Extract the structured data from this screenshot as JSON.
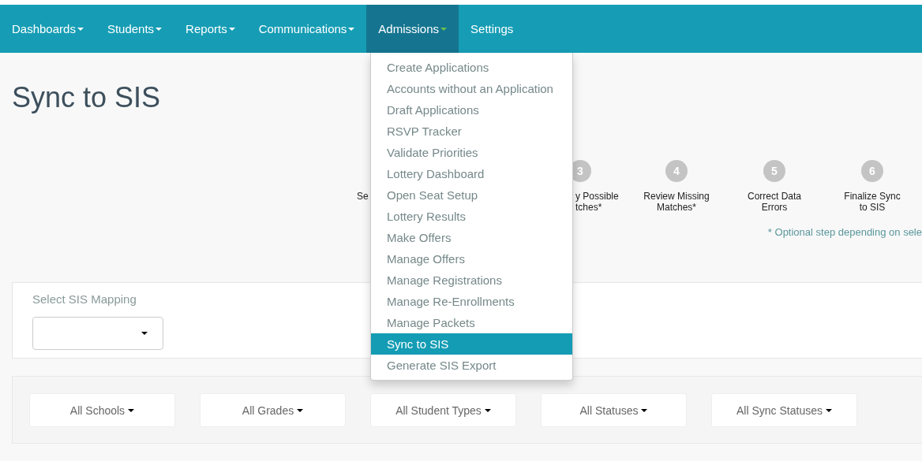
{
  "nav": {
    "items": [
      {
        "label": "Dashboards",
        "dropdown": true,
        "selected": false
      },
      {
        "label": "Students",
        "dropdown": true,
        "selected": false
      },
      {
        "label": "Reports",
        "dropdown": true,
        "selected": false
      },
      {
        "label": "Communications",
        "dropdown": true,
        "selected": false
      },
      {
        "label": "Admissions",
        "dropdown": true,
        "selected": true
      },
      {
        "label": "Settings",
        "dropdown": false,
        "selected": false
      }
    ]
  },
  "admissions_menu": {
    "items": [
      {
        "label": "Create Applications",
        "selected": false
      },
      {
        "label": "Accounts without an Application",
        "selected": false
      },
      {
        "label": "Draft Applications",
        "selected": false
      },
      {
        "label": "RSVP Tracker",
        "selected": false
      },
      {
        "label": "Validate Priorities",
        "selected": false
      },
      {
        "label": "Lottery Dashboard",
        "selected": false
      },
      {
        "label": "Open Seat Setup",
        "selected": false
      },
      {
        "label": "Lottery Results",
        "selected": false
      },
      {
        "label": "Make Offers",
        "selected": false
      },
      {
        "label": "Manage Offers",
        "selected": false
      },
      {
        "label": "Manage Registrations",
        "selected": false
      },
      {
        "label": "Manage Re-Enrollments",
        "selected": false
      },
      {
        "label": "Manage Packets",
        "selected": false
      },
      {
        "label": "Sync to SIS",
        "selected": true
      },
      {
        "label": "Generate SIS Export",
        "selected": false
      }
    ]
  },
  "page_title": "Sync to SIS",
  "steps": [
    {
      "kind": "partial",
      "label": [
        "Se"
      ]
    },
    {
      "kind": "partial",
      "number": "3",
      "label": [
        "y Possible",
        "tches*"
      ]
    },
    {
      "kind": "full",
      "number": "4",
      "label": [
        "Review Missing",
        "Matches*"
      ]
    },
    {
      "kind": "full",
      "number": "5",
      "label": [
        "Correct Data",
        "Errors"
      ]
    },
    {
      "kind": "full",
      "number": "6",
      "label": [
        "Finalize Sync",
        "to SIS"
      ]
    }
  ],
  "steps_note": "* Optional step depending on sele",
  "mapping": {
    "label": "Select SIS Mapping"
  },
  "filters": [
    "All Schools",
    "All Grades",
    "All Student Types",
    "All Statuses",
    "All Sync Statuses"
  ]
}
